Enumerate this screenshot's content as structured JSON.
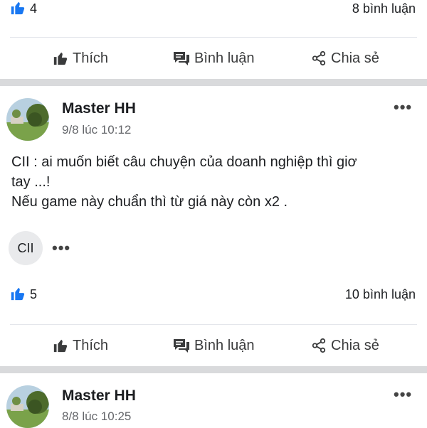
{
  "top_post": {
    "like_count": "4",
    "comment_count": "8 bình luận"
  },
  "actions": {
    "like": "Thích",
    "comment": "Bình luận",
    "share": "Chia sẻ"
  },
  "post": {
    "author": "Master HH",
    "timestamp": "9/8 lúc 10:12",
    "text_line1": "CII : ai muốn biết câu chuyện của doanh nghiệp thì giơ",
    "text_line2": "tay ...!",
    "text_line3": "Nếu game này chuẩn thì từ giá này còn x2 .",
    "tag_chip": "CII",
    "like_count": "5",
    "comment_count": "10 bình luận"
  },
  "next_post": {
    "author": "Master HH",
    "timestamp": "8/8 lúc 10:25"
  },
  "colors": {
    "like_blue": "#1877f2",
    "divider_gray": "#d9dadc"
  },
  "icons": [
    "like-thumb-icon",
    "thumbs-up-icon",
    "comment-bubble-icon",
    "share-icon",
    "more-dots-icon"
  ]
}
